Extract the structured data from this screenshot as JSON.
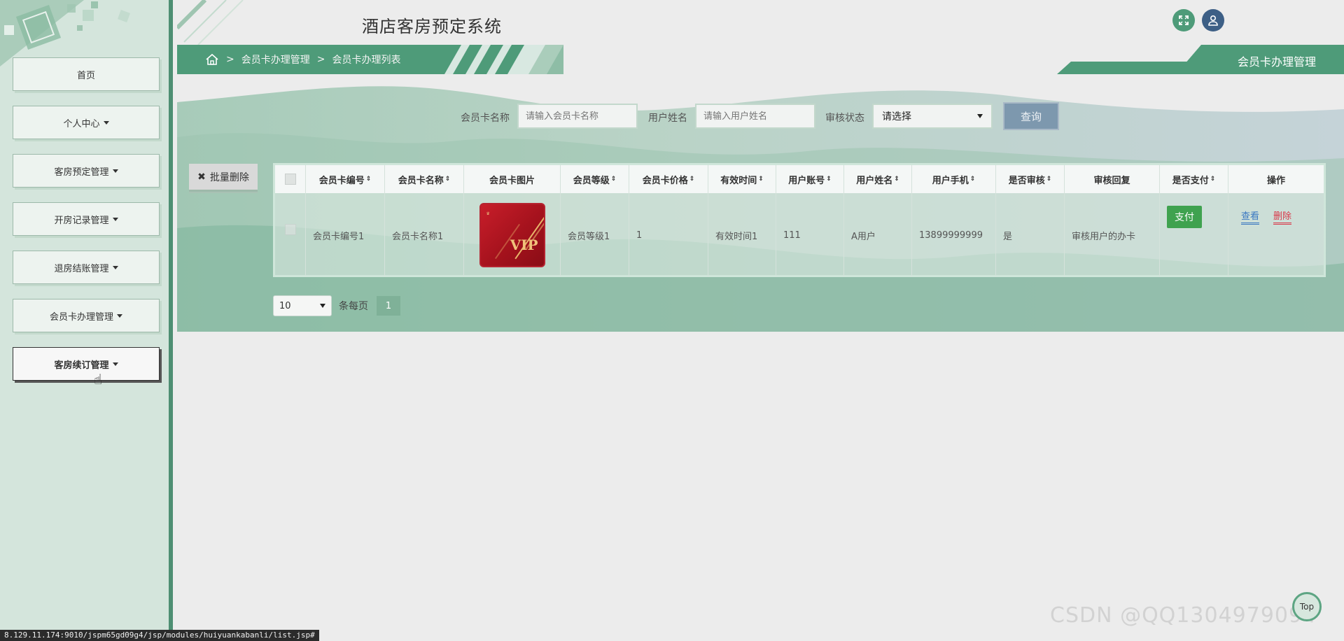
{
  "app": {
    "title": "酒店客房预定系统"
  },
  "sidebar": {
    "items": [
      {
        "label": "首页"
      },
      {
        "label": "个人中心"
      },
      {
        "label": "客房预定管理"
      },
      {
        "label": "开房记录管理"
      },
      {
        "label": "退房结账管理"
      },
      {
        "label": "会员卡办理管理"
      },
      {
        "label": "客房续订管理"
      }
    ]
  },
  "breadcrumb": {
    "sep": ">",
    "level1": "会员卡办理管理",
    "level2": "会员卡办理列表"
  },
  "page_title": "会员卡办理管理",
  "search": {
    "card_name_label": "会员卡名称",
    "card_name_placeholder": "请输入会员卡名称",
    "user_name_label": "用户姓名",
    "user_name_placeholder": "请输入用户姓名",
    "audit_label": "审核状态",
    "audit_selected": "请选择",
    "query_label": "查询"
  },
  "batch_delete_label": "批量删除",
  "table": {
    "headers": [
      "会员卡编号",
      "会员卡名称",
      "会员卡图片",
      "会员等级",
      "会员卡价格",
      "有效时间",
      "用户账号",
      "用户姓名",
      "用户手机",
      "是否审核",
      "审核回复",
      "是否支付",
      "操作"
    ],
    "sort_glyph": "⇕",
    "rows": [
      {
        "card_no": "会员卡编号1",
        "card_name": "会员卡名称1",
        "card_image_text": "VIP",
        "level": "会员等级1",
        "price": "1",
        "valid_time": "有效时间1",
        "account": "111",
        "user_name": "A用户",
        "phone": "13899999999",
        "audited": "是",
        "audit_reply": "审核用户的办卡",
        "pay_label": "支付",
        "view_label": "查看",
        "delete_label": "删除"
      }
    ]
  },
  "pager": {
    "page_size": "10",
    "per_page_label": "条每页",
    "current_page": "1"
  },
  "status_url": "8.129.11.174:9010/jspm65gd09g4/jsp/modules/huiyuankabanli/list.jsp#",
  "watermark": "CSDN @QQ1304979094",
  "top_label": "Top",
  "colors": {
    "primary_green": "#4e9b79",
    "query_button": "#7d98ae",
    "pay_green": "#3fa24f",
    "view_blue": "#3a78c2",
    "delete_red": "#d9394a"
  }
}
